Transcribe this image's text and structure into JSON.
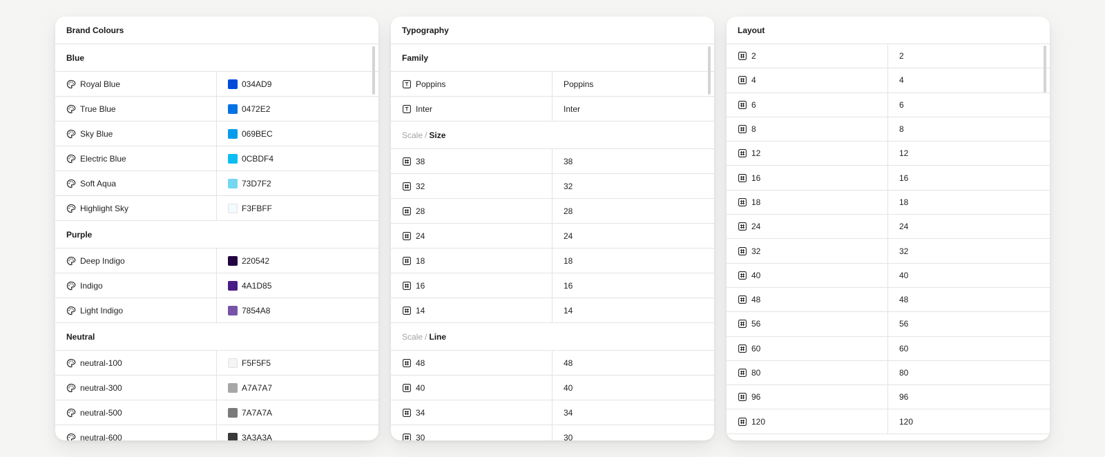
{
  "panels": {
    "brand": {
      "title": "Brand Colours",
      "groups": [
        {
          "label": "Blue",
          "items": [
            {
              "name": "Royal Blue",
              "hex": "034AD9",
              "color": "#034AD9"
            },
            {
              "name": "True Blue",
              "hex": "0472E2",
              "color": "#0472E2"
            },
            {
              "name": "Sky Blue",
              "hex": "069BEC",
              "color": "#069BEC"
            },
            {
              "name": "Electric Blue",
              "hex": "0CBDF4",
              "color": "#0CBDF4"
            },
            {
              "name": "Soft Aqua",
              "hex": "73D7F2",
              "color": "#73D7F2"
            },
            {
              "name": "Highlight Sky",
              "hex": "F3FBFF",
              "color": "#F3FBFF"
            }
          ]
        },
        {
          "label": "Purple",
          "items": [
            {
              "name": "Deep Indigo",
              "hex": "220542",
              "color": "#220542"
            },
            {
              "name": "Indigo",
              "hex": "4A1D85",
              "color": "#4A1D85"
            },
            {
              "name": "Light Indigo",
              "hex": "7854A8",
              "color": "#7854A8"
            }
          ]
        },
        {
          "label": "Neutral",
          "items": [
            {
              "name": "neutral-100",
              "hex": "F5F5F5",
              "color": "#F5F5F5"
            },
            {
              "name": "neutral-300",
              "hex": "A7A7A7",
              "color": "#A7A7A7"
            },
            {
              "name": "neutral-500",
              "hex": "7A7A7A",
              "color": "#7A7A7A"
            },
            {
              "name": "neutral-600",
              "hex": "3A3A3A",
              "color": "#3A3A3A"
            }
          ]
        }
      ]
    },
    "typography": {
      "title": "Typography",
      "family": {
        "label": "Family",
        "items": [
          {
            "name": "Poppins",
            "value": "Poppins"
          },
          {
            "name": "Inter",
            "value": "Inter"
          }
        ]
      },
      "scale_size": {
        "prefix": "Scale",
        "separator": "/",
        "label": "Size",
        "items": [
          {
            "name": "38",
            "value": "38"
          },
          {
            "name": "32",
            "value": "32"
          },
          {
            "name": "28",
            "value": "28"
          },
          {
            "name": "24",
            "value": "24"
          },
          {
            "name": "18",
            "value": "18"
          },
          {
            "name": "16",
            "value": "16"
          },
          {
            "name": "14",
            "value": "14"
          }
        ]
      },
      "scale_line": {
        "prefix": "Scale",
        "separator": "/",
        "label": "Line",
        "items": [
          {
            "name": "48",
            "value": "48"
          },
          {
            "name": "40",
            "value": "40"
          },
          {
            "name": "34",
            "value": "34"
          },
          {
            "name": "30",
            "value": "30"
          }
        ]
      }
    },
    "layout": {
      "title": "Layout",
      "items": [
        {
          "name": "2",
          "value": "2"
        },
        {
          "name": "4",
          "value": "4"
        },
        {
          "name": "6",
          "value": "6"
        },
        {
          "name": "8",
          "value": "8"
        },
        {
          "name": "12",
          "value": "12"
        },
        {
          "name": "16",
          "value": "16"
        },
        {
          "name": "18",
          "value": "18"
        },
        {
          "name": "24",
          "value": "24"
        },
        {
          "name": "32",
          "value": "32"
        },
        {
          "name": "40",
          "value": "40"
        },
        {
          "name": "48",
          "value": "48"
        },
        {
          "name": "56",
          "value": "56"
        },
        {
          "name": "60",
          "value": "60"
        },
        {
          "name": "80",
          "value": "80"
        },
        {
          "name": "96",
          "value": "96"
        },
        {
          "name": "120",
          "value": "120"
        }
      ]
    }
  },
  "icons": {
    "color": "palette-icon",
    "font": "text-type-icon",
    "number": "number-hash-icon"
  }
}
